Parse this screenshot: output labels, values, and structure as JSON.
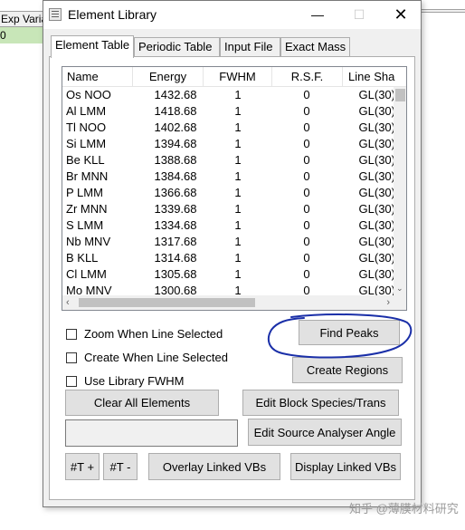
{
  "background": {
    "header_cell": "Exp Varia",
    "green_cell": "0"
  },
  "window": {
    "title": "Element Library",
    "minimize_glyph": "—",
    "maximize_glyph": "☐",
    "close_glyph": "✕"
  },
  "tabs": [
    {
      "label": "Element Table",
      "active": true
    },
    {
      "label": "Periodic Table",
      "active": false
    },
    {
      "label": "Input File",
      "active": false
    },
    {
      "label": "Exact Mass",
      "active": false
    }
  ],
  "table": {
    "columns": [
      "Name",
      "Energy",
      "FWHM",
      "R.S.F.",
      "Line Sha"
    ],
    "rows": [
      [
        "Os NOO",
        "1432.68",
        "1",
        "0",
        "GL(30)"
      ],
      [
        "Al LMM",
        "1418.68",
        "1",
        "0",
        "GL(30)"
      ],
      [
        "Tl NOO",
        "1402.68",
        "1",
        "0",
        "GL(30)"
      ],
      [
        "Si LMM",
        "1394.68",
        "1",
        "0",
        "GL(30)"
      ],
      [
        "Be KLL",
        "1388.68",
        "1",
        "0",
        "GL(30)"
      ],
      [
        "Br MNN",
        "1384.68",
        "1",
        "0",
        "GL(30)"
      ],
      [
        "P LMM",
        "1366.68",
        "1",
        "0",
        "GL(30)"
      ],
      [
        "Zr MNN",
        "1339.68",
        "1",
        "0",
        "GL(30)"
      ],
      [
        "S LMM",
        "1334.68",
        "1",
        "0",
        "GL(30)"
      ],
      [
        "Nb MNV",
        "1317.68",
        "1",
        "0",
        "GL(30)"
      ],
      [
        "B KLL",
        "1314.68",
        "1",
        "0",
        "GL(30)"
      ],
      [
        "Cl LMM",
        "1305.68",
        "1",
        "0",
        "GL(30)"
      ],
      [
        "Mo MNV",
        "1300.68",
        "1",
        "0",
        "GL(30)"
      ]
    ],
    "scroll_left": "‹",
    "scroll_right": "›",
    "scroll_down": "⌄"
  },
  "options": {
    "zoom_when_line_selected": "Zoom When Line Selected",
    "create_when_line_selected": "Create When Line Selected",
    "use_library_fwhm": "Use Library FWHM"
  },
  "buttons": {
    "find_peaks": "Find Peaks",
    "create_regions": "Create Regions",
    "clear_all_elements": "Clear All Elements",
    "edit_block_species": "Edit Block Species/Trans",
    "edit_source_analyser_angle": "Edit Source Analyser Angle",
    "t_plus": "#T +",
    "t_minus": "#T -",
    "overlay_linked_vbs": "Overlay Linked VBs",
    "display_linked_vbs": "Display Linked VBs"
  },
  "annotation_color": "#1a2fa8",
  "watermark": "知乎 @薄膜材料研究"
}
